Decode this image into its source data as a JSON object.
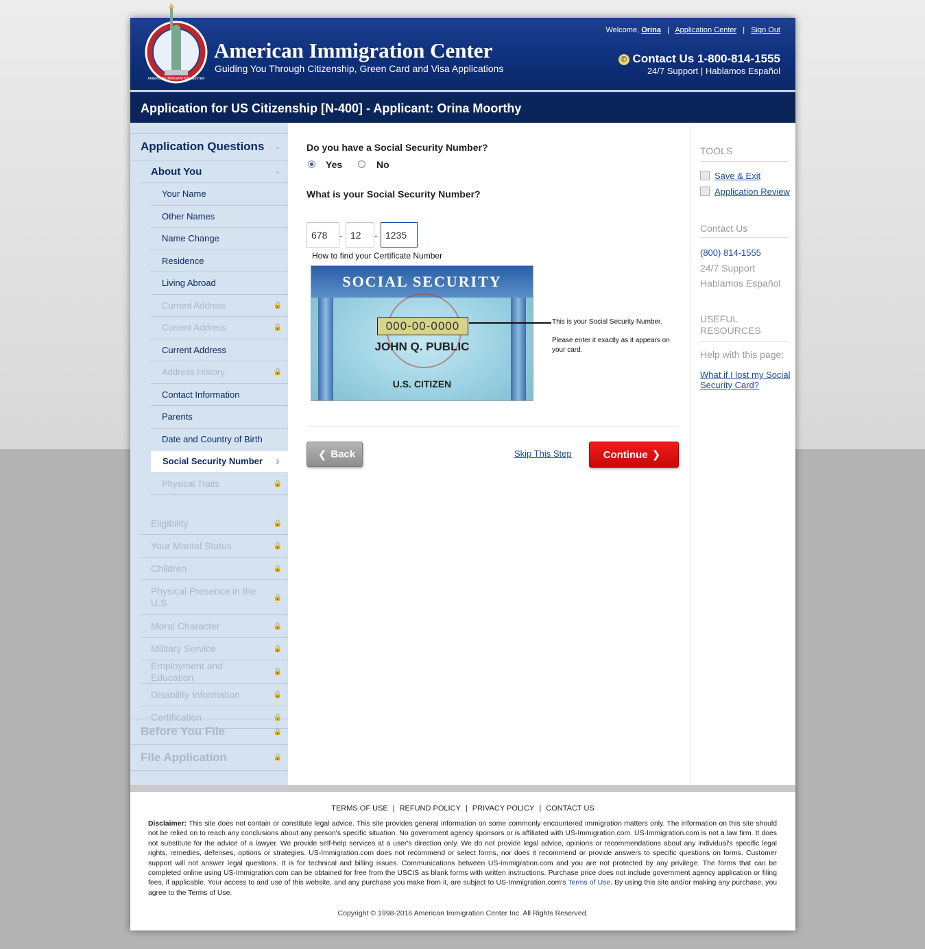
{
  "header": {
    "brand_title": "American Immigration Center",
    "brand_tagline": "Guiding You Through Citizenship, Green Card and Visa Applications",
    "welcome_text": "Welcome,",
    "user_name": "Orina",
    "application_center_link": "Application Center",
    "sign_out_link": "Sign Out",
    "contact_label": "Contact Us 1-800-814-1555",
    "support_line": "24/7 Support | Hablamos Español"
  },
  "page_title": "Application for US Citizenship [N-400] - Applicant: Orina Moorthy",
  "sidebar": {
    "section_application_questions": "Application Questions",
    "section_about_you": "About You",
    "about_you_items": [
      {
        "label": "Your Name",
        "locked": false
      },
      {
        "label": "Other Names",
        "locked": false
      },
      {
        "label": "Name Change",
        "locked": false
      },
      {
        "label": "Residence",
        "locked": false
      },
      {
        "label": "Living Abroad",
        "locked": false
      },
      {
        "label": "Current Address",
        "locked": true
      },
      {
        "label": "Current Address",
        "locked": true
      },
      {
        "label": "Current Address",
        "locked": false
      },
      {
        "label": "Address History",
        "locked": true
      },
      {
        "label": "Contact Information",
        "locked": false
      },
      {
        "label": "Parents",
        "locked": false
      },
      {
        "label": "Date and Country of Birth",
        "locked": false
      },
      {
        "label": "Social Security Number",
        "locked": false,
        "active": true
      },
      {
        "label": "Physical Traits",
        "locked": true
      }
    ],
    "sections": [
      "Eligibility",
      "Your Marital Status",
      "Children",
      "Physical Presence in the U.S.",
      "Moral Character",
      "Military Service",
      "Employment and Education",
      "Disability Information",
      "Certification"
    ],
    "section_before_you_file": "Before You File",
    "section_file_application": "File Application"
  },
  "main": {
    "question_has_ssn": "Do you have a Social Security Number?",
    "option_yes": "Yes",
    "option_no": "No",
    "selected_option": "Yes",
    "question_ssn": "What is your Social Security Number?",
    "ssn_part1": "678",
    "ssn_part2": "12",
    "ssn_part3": "1235",
    "ssn_separator": "-",
    "card_caption": "How to find your Certificate Number",
    "card_title": "SOCIAL SECURITY",
    "card_number": "000-00-0000",
    "card_name": "JOHN Q. PUBLIC",
    "card_citizen": "U.S. CITIZEN",
    "card_note_1": "This is your Social Security Number.",
    "card_note_2": "Please enter it exactly as it appears on your card.",
    "back_button": "Back",
    "skip_link": "Skip This Step",
    "continue_button": "Continue"
  },
  "right": {
    "tools_heading": "TOOLS",
    "save_exit": "Save & Exit",
    "application_review": "Application Review",
    "contact_heading": "Contact Us",
    "phone": "(800) 814-1555",
    "support": "24/7 Support",
    "hablamos": "Hablamos Español",
    "resources_heading_1": "USEFUL",
    "resources_heading_2": "RESOURCES",
    "help_label": "Help with this page:",
    "help_link": "What if I lost my Social Security Card?"
  },
  "footer": {
    "links": [
      "TERMS OF USE",
      "REFUND POLICY",
      "PRIVACY POLICY",
      "CONTACT US"
    ],
    "link_separator": "|",
    "disclaimer_label": "Disclaimer:",
    "disclaimer_text": "This site does not contain or constitute legal advice. This site provides general information on some commonly encountered immigration matters only. The information on this site should not be relied on to reach any conclusions about any person's specific situation. No government agency sponsors or is affiliated with US-Immigration.com. US-Immigration.com is not a law firm. It does not substitute for the advice of a lawyer. We provide self-help services at a user's direction only. We do not provide legal advice, opinions or recommendations about any individual's specific legal rights, remedies, defenses, options or strategies. US-Immigration.com does not recommend or select forms, nor does it recommend or provide answers to specific questions on forms. Customer support will not answer legal questions. It is for technical and billing issues. Communications between US-Immigration.com and you are not protected by any privilege. The forms that can be completed online using US-Immigration.com can be obtained for free from the USCIS as blank forms with written instructions. Purchase price does not include government agency application or filing fees, if applicable. Your access to and use of this website, and any purchase you make from it, are subject to US-Immigration.com's",
    "disclaimer_terms_link": "Terms of Use",
    "disclaimer_tail": ". By using this site and/or making any purchase, you agree to the Terms of Use.",
    "copyright": "Copyright © 1998-2016 American Immigration Center Inc. All Rights Reserved."
  }
}
